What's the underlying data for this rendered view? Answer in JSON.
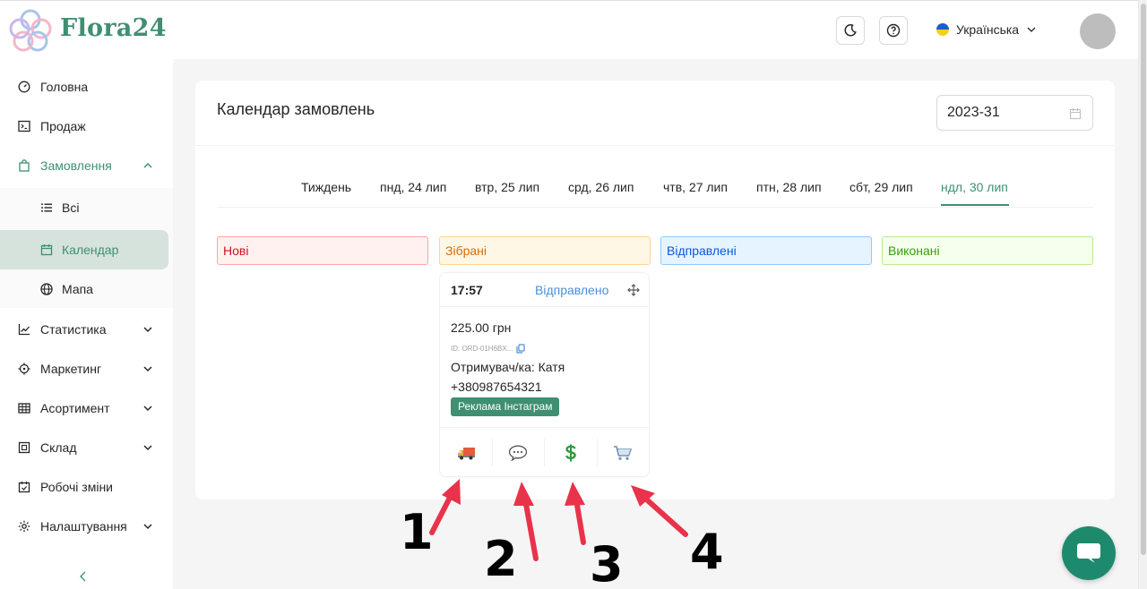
{
  "app": {
    "name": "Flora24"
  },
  "header": {
    "language": "Українська"
  },
  "sidebar": {
    "items": [
      {
        "label": "Головна"
      },
      {
        "label": "Продаж"
      },
      {
        "label": "Замовлення"
      },
      {
        "label": "Статистика"
      },
      {
        "label": "Маркетинг"
      },
      {
        "label": "Асортимент"
      },
      {
        "label": "Склад"
      },
      {
        "label": "Робочі зміни"
      },
      {
        "label": "Налаштування"
      }
    ],
    "orders_sub": [
      {
        "label": "Всі"
      },
      {
        "label": "Календар"
      },
      {
        "label": "Мапа"
      }
    ]
  },
  "page": {
    "title": "Календар замовлень",
    "week_value": "2023-31"
  },
  "tabs": [
    {
      "label": "Тиждень"
    },
    {
      "label": "пнд, 24 лип"
    },
    {
      "label": "втр, 25 лип"
    },
    {
      "label": "срд, 26 лип"
    },
    {
      "label": "чтв, 27 лип"
    },
    {
      "label": "птн, 28 лип"
    },
    {
      "label": "сбт, 29 лип"
    },
    {
      "label": "ндл, 30 лип"
    }
  ],
  "columns": {
    "new": "Нові",
    "collected": "Зібрані",
    "sent": "Відправлені",
    "done": "Виконані"
  },
  "order": {
    "time": "17:57",
    "status": "Відправлено",
    "price": "225.00 грн",
    "id": "ID: ORD-01H6BX...",
    "recipient": "Отримувач/ка: Катя",
    "phone": "+380987654321",
    "tag": "Реклама Інстаграм"
  },
  "annotations": [
    "1",
    "2",
    "3",
    "4"
  ],
  "colors": {
    "brand": "#3f8f72",
    "arrow": "#e8334a",
    "status_sent": "#4a8fd9"
  }
}
